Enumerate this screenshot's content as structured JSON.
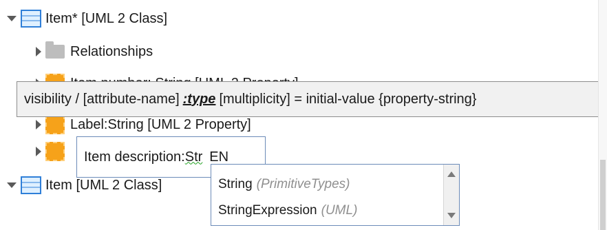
{
  "tree": {
    "class1_label": "Item* [UML 2 Class]",
    "relationships_label": "Relationships",
    "prop1_label_partial": "Item number: String [UML 2 Property]",
    "prop2_label_partial": "Label:String [UML 2 Property]",
    "class2_label": "Item [UML 2 Class]"
  },
  "tooltip": {
    "before": "visibility / [attribute-name]",
    "type": ":type",
    "after": "[multiplicity] = initial-value {property-string}"
  },
  "editor": {
    "value_prefix": "Item description:",
    "value_squiggle": "Str",
    "language": "EN"
  },
  "completion": {
    "items": [
      {
        "name": "String",
        "hint": "(PrimitiveTypes)"
      },
      {
        "name": "StringExpression",
        "hint": "(UML)"
      }
    ]
  },
  "icons": {
    "class": "uml-class-icon",
    "folder": "folder-icon",
    "property": "uml-property-icon"
  },
  "colors": {
    "class_icon": "#2f7fd8",
    "property_icon": "#f6a21a",
    "squiggle": "#1ea01e"
  }
}
